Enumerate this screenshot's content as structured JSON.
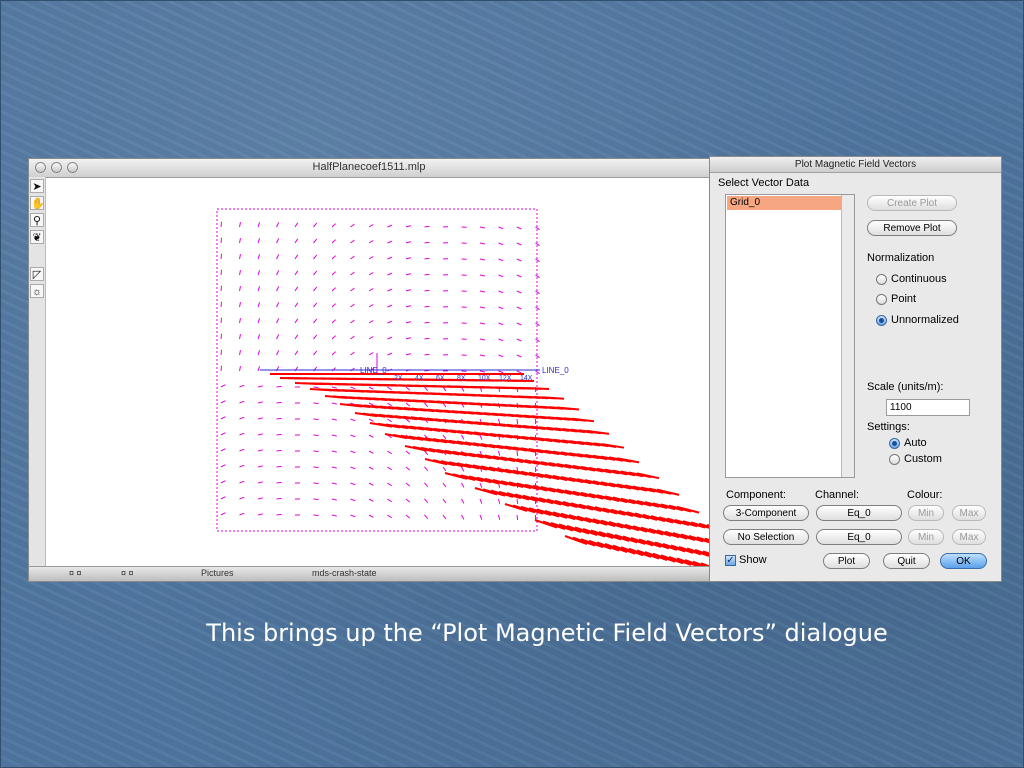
{
  "plot_window": {
    "title": "HalfPlanecoef1511.mlp",
    "tools": [
      "arrow-pointer-icon",
      "hand-pan-icon",
      "zoom-magnifier-icon",
      "brain-icon",
      "edit-triangle-icon",
      "sun-icon"
    ],
    "line_label_left": "LINE_0",
    "line_label_right": "LINE_0",
    "scale_ticks": [
      "2X",
      "4X",
      "6X",
      "8X",
      "10X",
      "12X",
      "14X"
    ],
    "vector_color": "#e000e0",
    "field_color": "#ff0000",
    "line_color": "#2b2bd0",
    "taskbar_items": [
      "Pictures",
      "mds-crash-state"
    ]
  },
  "dialog": {
    "title": "Plot Magnetic Field Vectors",
    "select_label": "Select Vector Data",
    "list_items": [
      "Grid_0"
    ],
    "create_plot": "Create Plot",
    "remove_plot": "Remove Plot",
    "normalization_label": "Normalization",
    "normalization_options": [
      "Continuous",
      "Point",
      "Unnormalized"
    ],
    "normalization_selected": "Unnormalized",
    "scale_label": "Scale (units/m):",
    "scale_value": "1100",
    "settings_label": "Settings:",
    "settings_options": [
      "Auto",
      "Custom"
    ],
    "settings_selected": "Auto",
    "component_label": "Component:",
    "channel_label": "Channel:",
    "colour_label": "Colour:",
    "component_1": "3-Component",
    "component_2": "No Selection",
    "channel_1": "Eq_0",
    "channel_2": "Eq_0",
    "min_label": "Min",
    "max_label": "Max",
    "show_label": "Show",
    "show_checked": true,
    "plot_button": "Plot",
    "quit_button": "Quit",
    "ok_button": "OK",
    "list_selection_color": "#f7a682",
    "default_button_color": "#5aa0e8"
  },
  "caption": "This brings up the “Plot Magnetic Field Vectors” dialogue"
}
